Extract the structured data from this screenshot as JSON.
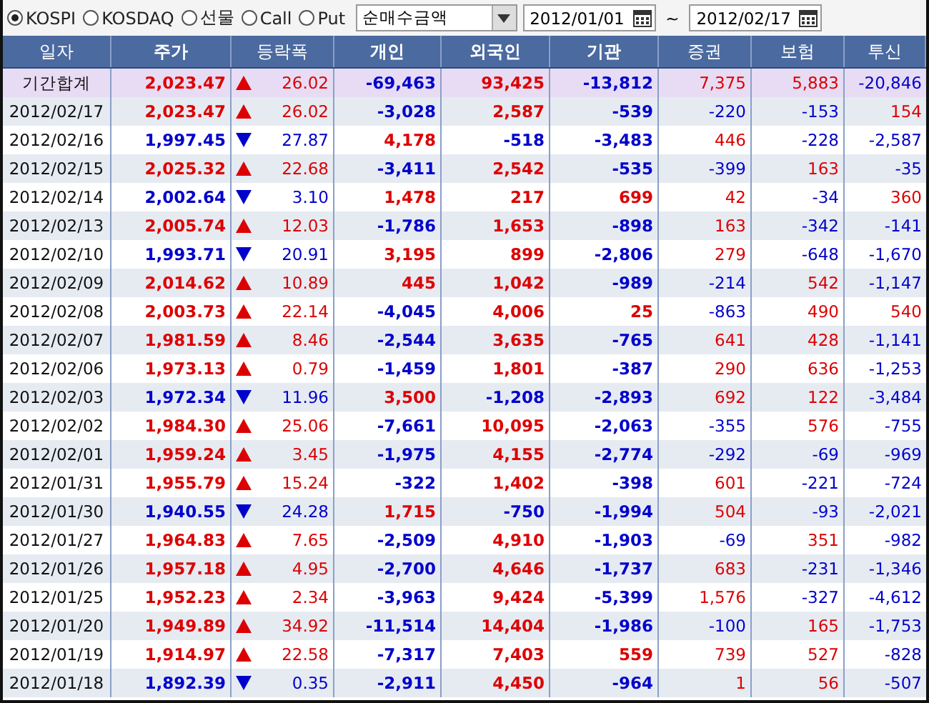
{
  "toolbar": {
    "markets": [
      {
        "label": "KOSPI",
        "selected": true
      },
      {
        "label": "KOSDAQ",
        "selected": false
      },
      {
        "label": "선물",
        "selected": false
      },
      {
        "label": "Call",
        "selected": false
      },
      {
        "label": "Put",
        "selected": false
      }
    ],
    "measure": "순매수금액",
    "date_from": "2012/01/01",
    "separator": "~",
    "date_to": "2012/02/17"
  },
  "table": {
    "columns": [
      {
        "label": "일자",
        "bold": false
      },
      {
        "label": "주가",
        "bold": true
      },
      {
        "label": "등락폭",
        "bold": false
      },
      {
        "label": "개인",
        "bold": true
      },
      {
        "label": "외국인",
        "bold": true
      },
      {
        "label": "기관",
        "bold": true
      },
      {
        "label": "증권",
        "bold": false
      },
      {
        "label": "보험",
        "bold": false
      },
      {
        "label": "투신",
        "bold": false
      }
    ],
    "rows": [
      {
        "cells": [
          {
            "value": "기간합계"
          },
          {
            "value": "2,023.47"
          },
          {
            "value": "26.02"
          },
          {
            "value": "-69,463",
            "negative": true
          },
          {
            "value": "93,425",
            "negative": false
          },
          {
            "value": "-13,812",
            "negative": true
          },
          {
            "value": "7,375",
            "negative": false
          },
          {
            "value": "5,883",
            "negative": false
          },
          {
            "value": "-20,846",
            "negative": true
          }
        ],
        "up": true,
        "kind": "total"
      },
      {
        "cells": [
          {
            "value": "2012/02/17"
          },
          {
            "value": "2,023.47"
          },
          {
            "value": "26.02"
          },
          {
            "value": "-3,028",
            "negative": true
          },
          {
            "value": "2,587",
            "negative": false
          },
          {
            "value": "-539",
            "negative": true
          },
          {
            "value": "-220",
            "negative": true
          },
          {
            "value": "-153",
            "negative": true
          },
          {
            "value": "154",
            "negative": false
          }
        ],
        "up": true,
        "kind": "day"
      },
      {
        "cells": [
          {
            "value": "2012/02/16"
          },
          {
            "value": "1,997.45"
          },
          {
            "value": "27.87"
          },
          {
            "value": "4,178",
            "negative": false
          },
          {
            "value": "-518",
            "negative": true
          },
          {
            "value": "-3,483",
            "negative": true
          },
          {
            "value": "446",
            "negative": false
          },
          {
            "value": "-228",
            "negative": true
          },
          {
            "value": "-2,587",
            "negative": true
          }
        ],
        "up": false,
        "kind": "day"
      },
      {
        "cells": [
          {
            "value": "2012/02/15"
          },
          {
            "value": "2,025.32"
          },
          {
            "value": "22.68"
          },
          {
            "value": "-3,411",
            "negative": true
          },
          {
            "value": "2,542",
            "negative": false
          },
          {
            "value": "-535",
            "negative": true
          },
          {
            "value": "-399",
            "negative": true
          },
          {
            "value": "163",
            "negative": false
          },
          {
            "value": "-35",
            "negative": true
          }
        ],
        "up": true,
        "kind": "day"
      },
      {
        "cells": [
          {
            "value": "2012/02/14"
          },
          {
            "value": "2,002.64"
          },
          {
            "value": "3.10"
          },
          {
            "value": "1,478",
            "negative": false
          },
          {
            "value": "217",
            "negative": false
          },
          {
            "value": "699",
            "negative": false
          },
          {
            "value": "42",
            "negative": false
          },
          {
            "value": "-34",
            "negative": true
          },
          {
            "value": "360",
            "negative": false
          }
        ],
        "up": false,
        "kind": "day"
      },
      {
        "cells": [
          {
            "value": "2012/02/13"
          },
          {
            "value": "2,005.74"
          },
          {
            "value": "12.03"
          },
          {
            "value": "-1,786",
            "negative": true
          },
          {
            "value": "1,653",
            "negative": false
          },
          {
            "value": "-898",
            "negative": true
          },
          {
            "value": "163",
            "negative": false
          },
          {
            "value": "-342",
            "negative": true
          },
          {
            "value": "-141",
            "negative": true
          }
        ],
        "up": true,
        "kind": "day"
      },
      {
        "cells": [
          {
            "value": "2012/02/10"
          },
          {
            "value": "1,993.71"
          },
          {
            "value": "20.91"
          },
          {
            "value": "3,195",
            "negative": false
          },
          {
            "value": "899",
            "negative": false
          },
          {
            "value": "-2,806",
            "negative": true
          },
          {
            "value": "279",
            "negative": false
          },
          {
            "value": "-648",
            "negative": true
          },
          {
            "value": "-1,670",
            "negative": true
          }
        ],
        "up": false,
        "kind": "day"
      },
      {
        "cells": [
          {
            "value": "2012/02/09"
          },
          {
            "value": "2,014.62"
          },
          {
            "value": "10.89"
          },
          {
            "value": "445",
            "negative": false
          },
          {
            "value": "1,042",
            "negative": false
          },
          {
            "value": "-989",
            "negative": true
          },
          {
            "value": "-214",
            "negative": true
          },
          {
            "value": "542",
            "negative": false
          },
          {
            "value": "-1,147",
            "negative": true
          }
        ],
        "up": true,
        "kind": "day"
      },
      {
        "cells": [
          {
            "value": "2012/02/08"
          },
          {
            "value": "2,003.73"
          },
          {
            "value": "22.14"
          },
          {
            "value": "-4,045",
            "negative": true
          },
          {
            "value": "4,006",
            "negative": false
          },
          {
            "value": "25",
            "negative": false
          },
          {
            "value": "-863",
            "negative": true
          },
          {
            "value": "490",
            "negative": false
          },
          {
            "value": "540",
            "negative": false
          }
        ],
        "up": true,
        "kind": "day"
      },
      {
        "cells": [
          {
            "value": "2012/02/07"
          },
          {
            "value": "1,981.59"
          },
          {
            "value": "8.46"
          },
          {
            "value": "-2,544",
            "negative": true
          },
          {
            "value": "3,635",
            "negative": false
          },
          {
            "value": "-765",
            "negative": true
          },
          {
            "value": "641",
            "negative": false
          },
          {
            "value": "428",
            "negative": false
          },
          {
            "value": "-1,141",
            "negative": true
          }
        ],
        "up": true,
        "kind": "day"
      },
      {
        "cells": [
          {
            "value": "2012/02/06"
          },
          {
            "value": "1,973.13"
          },
          {
            "value": "0.79"
          },
          {
            "value": "-1,459",
            "negative": true
          },
          {
            "value": "1,801",
            "negative": false
          },
          {
            "value": "-387",
            "negative": true
          },
          {
            "value": "290",
            "negative": false
          },
          {
            "value": "636",
            "negative": false
          },
          {
            "value": "-1,253",
            "negative": true
          }
        ],
        "up": true,
        "kind": "day"
      },
      {
        "cells": [
          {
            "value": "2012/02/03"
          },
          {
            "value": "1,972.34"
          },
          {
            "value": "11.96"
          },
          {
            "value": "3,500",
            "negative": false
          },
          {
            "value": "-1,208",
            "negative": true
          },
          {
            "value": "-2,893",
            "negative": true
          },
          {
            "value": "692",
            "negative": false
          },
          {
            "value": "122",
            "negative": false
          },
          {
            "value": "-3,484",
            "negative": true
          }
        ],
        "up": false,
        "kind": "day"
      },
      {
        "cells": [
          {
            "value": "2012/02/02"
          },
          {
            "value": "1,984.30"
          },
          {
            "value": "25.06"
          },
          {
            "value": "-7,661",
            "negative": true
          },
          {
            "value": "10,095",
            "negative": false
          },
          {
            "value": "-2,063",
            "negative": true
          },
          {
            "value": "-355",
            "negative": true
          },
          {
            "value": "576",
            "negative": false
          },
          {
            "value": "-755",
            "negative": true
          }
        ],
        "up": true,
        "kind": "day"
      },
      {
        "cells": [
          {
            "value": "2012/02/01"
          },
          {
            "value": "1,959.24"
          },
          {
            "value": "3.45"
          },
          {
            "value": "-1,975",
            "negative": true
          },
          {
            "value": "4,155",
            "negative": false
          },
          {
            "value": "-2,774",
            "negative": true
          },
          {
            "value": "-292",
            "negative": true
          },
          {
            "value": "-69",
            "negative": true
          },
          {
            "value": "-969",
            "negative": true
          }
        ],
        "up": true,
        "kind": "day"
      },
      {
        "cells": [
          {
            "value": "2012/01/31"
          },
          {
            "value": "1,955.79"
          },
          {
            "value": "15.24"
          },
          {
            "value": "-322",
            "negative": true
          },
          {
            "value": "1,402",
            "negative": false
          },
          {
            "value": "-398",
            "negative": true
          },
          {
            "value": "601",
            "negative": false
          },
          {
            "value": "-221",
            "negative": true
          },
          {
            "value": "-724",
            "negative": true
          }
        ],
        "up": true,
        "kind": "day"
      },
      {
        "cells": [
          {
            "value": "2012/01/30"
          },
          {
            "value": "1,940.55"
          },
          {
            "value": "24.28"
          },
          {
            "value": "1,715",
            "negative": false
          },
          {
            "value": "-750",
            "negative": true
          },
          {
            "value": "-1,994",
            "negative": true
          },
          {
            "value": "504",
            "negative": false
          },
          {
            "value": "-93",
            "negative": true
          },
          {
            "value": "-2,021",
            "negative": true
          }
        ],
        "up": false,
        "kind": "day"
      },
      {
        "cells": [
          {
            "value": "2012/01/27"
          },
          {
            "value": "1,964.83"
          },
          {
            "value": "7.65"
          },
          {
            "value": "-2,509",
            "negative": true
          },
          {
            "value": "4,910",
            "negative": false
          },
          {
            "value": "-1,903",
            "negative": true
          },
          {
            "value": "-69",
            "negative": true
          },
          {
            "value": "351",
            "negative": false
          },
          {
            "value": "-982",
            "negative": true
          }
        ],
        "up": true,
        "kind": "day"
      },
      {
        "cells": [
          {
            "value": "2012/01/26"
          },
          {
            "value": "1,957.18"
          },
          {
            "value": "4.95"
          },
          {
            "value": "-2,700",
            "negative": true
          },
          {
            "value": "4,646",
            "negative": false
          },
          {
            "value": "-1,737",
            "negative": true
          },
          {
            "value": "683",
            "negative": false
          },
          {
            "value": "-231",
            "negative": true
          },
          {
            "value": "-1,346",
            "negative": true
          }
        ],
        "up": true,
        "kind": "day"
      },
      {
        "cells": [
          {
            "value": "2012/01/25"
          },
          {
            "value": "1,952.23"
          },
          {
            "value": "2.34"
          },
          {
            "value": "-3,963",
            "negative": true
          },
          {
            "value": "9,424",
            "negative": false
          },
          {
            "value": "-5,399",
            "negative": true
          },
          {
            "value": "1,576",
            "negative": false
          },
          {
            "value": "-327",
            "negative": true
          },
          {
            "value": "-4,612",
            "negative": true
          }
        ],
        "up": true,
        "kind": "day"
      },
      {
        "cells": [
          {
            "value": "2012/01/20"
          },
          {
            "value": "1,949.89"
          },
          {
            "value": "34.92"
          },
          {
            "value": "-11,514",
            "negative": true
          },
          {
            "value": "14,404",
            "negative": false
          },
          {
            "value": "-1,986",
            "negative": true
          },
          {
            "value": "-100",
            "negative": true
          },
          {
            "value": "165",
            "negative": false
          },
          {
            "value": "-1,753",
            "negative": true
          }
        ],
        "up": true,
        "kind": "day"
      },
      {
        "cells": [
          {
            "value": "2012/01/19"
          },
          {
            "value": "1,914.97"
          },
          {
            "value": "22.58"
          },
          {
            "value": "-7,317",
            "negative": true
          },
          {
            "value": "7,403",
            "negative": false
          },
          {
            "value": "559",
            "negative": false
          },
          {
            "value": "739",
            "negative": false
          },
          {
            "value": "527",
            "negative": false
          },
          {
            "value": "-828",
            "negative": true
          }
        ],
        "up": true,
        "kind": "day"
      },
      {
        "cells": [
          {
            "value": "2012/01/18"
          },
          {
            "value": "1,892.39"
          },
          {
            "value": "0.35"
          },
          {
            "value": "-2,911",
            "negative": true
          },
          {
            "value": "4,450",
            "negative": false
          },
          {
            "value": "-964",
            "negative": true
          },
          {
            "value": "1",
            "negative": false
          },
          {
            "value": "56",
            "negative": false
          },
          {
            "value": "-507",
            "negative": true
          }
        ],
        "up": false,
        "kind": "day"
      }
    ]
  }
}
